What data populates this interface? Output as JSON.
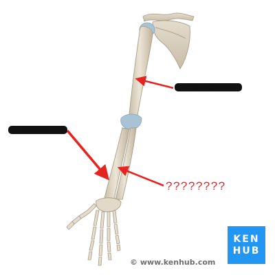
{
  "labels": {
    "hidden_label_1": "??????????",
    "hidden_label_2": "????????",
    "question_label": "????????"
  },
  "watermark": {
    "copyright": "© www.kenhub.com",
    "logo_top": "KEN",
    "logo_bottom": "HUB"
  },
  "colors": {
    "arrow": "#e5241f",
    "question_text": "#e3262b",
    "redaction": "#111111",
    "bone": "#ddd3c2",
    "cartilage": "#a9c3d6",
    "logo_bg": "#2196f3"
  },
  "icons": {
    "logo": "kenhub-logo"
  }
}
